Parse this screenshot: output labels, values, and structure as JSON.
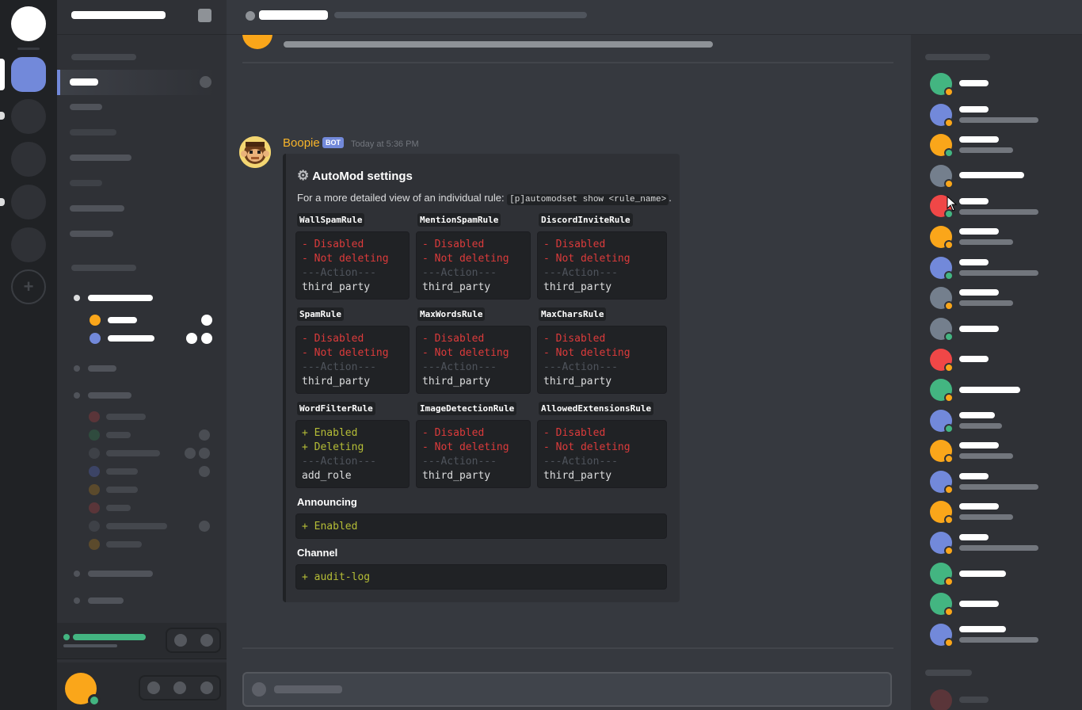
{
  "message": {
    "author": "Boopie",
    "bot_tag": "BOT",
    "timestamp": "Today at 5:36 PM",
    "author_color": "#f9b52a"
  },
  "embed": {
    "title": "AutoMod settings",
    "title_icon": "gear-icon",
    "description": "For a more detailed view of an individual rule: ",
    "description_code": "[p]automodset show <rule_name>",
    "description_end": ".",
    "rules": [
      {
        "name": "WallSpamRule",
        "line1": "- Disabled",
        "line2": "- Not deleting",
        "line3": "---Action---",
        "line4": "third_party"
      },
      {
        "name": "MentionSpamRule",
        "line1": "- Disabled",
        "line2": "- Not deleting",
        "line3": "---Action---",
        "line4": "third_party"
      },
      {
        "name": "DiscordInviteRule",
        "line1": "- Disabled",
        "line2": "- Not deleting",
        "line3": "---Action---",
        "line4": "third_party"
      },
      {
        "name": "SpamRule",
        "line1": "- Disabled",
        "line2": "- Not deleting",
        "line3": "---Action---",
        "line4": "third_party"
      },
      {
        "name": "MaxWordsRule",
        "line1": "- Disabled",
        "line2": "- Not deleting",
        "line3": "---Action---",
        "line4": "third_party"
      },
      {
        "name": "MaxCharsRule",
        "line1": "- Disabled",
        "line2": "- Not deleting",
        "line3": "---Action---",
        "line4": "third_party"
      },
      {
        "name": "WordFilterRule",
        "line1": "+ Enabled",
        "line2": "+ Deleting",
        "line3": "---Action---",
        "line4": "add_role"
      },
      {
        "name": "ImageDetectionRule",
        "line1": "- Disabled",
        "line2": "- Not deleting",
        "line3": "---Action---",
        "line4": "third_party"
      },
      {
        "name": "AllowedExtensionsRule",
        "line1": "- Disabled",
        "line2": "- Not deleting",
        "line3": "---Action---",
        "line4": "third_party"
      }
    ],
    "announcing_label": "Announcing",
    "announcing_value": "+ Enabled",
    "channel_label": "Channel",
    "channel_value": "+ audit-log"
  },
  "colors": {
    "accent": "#7289da",
    "diff_removed": "#dc3b3b",
    "diff_added": "#b5bd36",
    "online": "#43b581",
    "idle": "#faa61a",
    "dnd": "#f04747"
  }
}
